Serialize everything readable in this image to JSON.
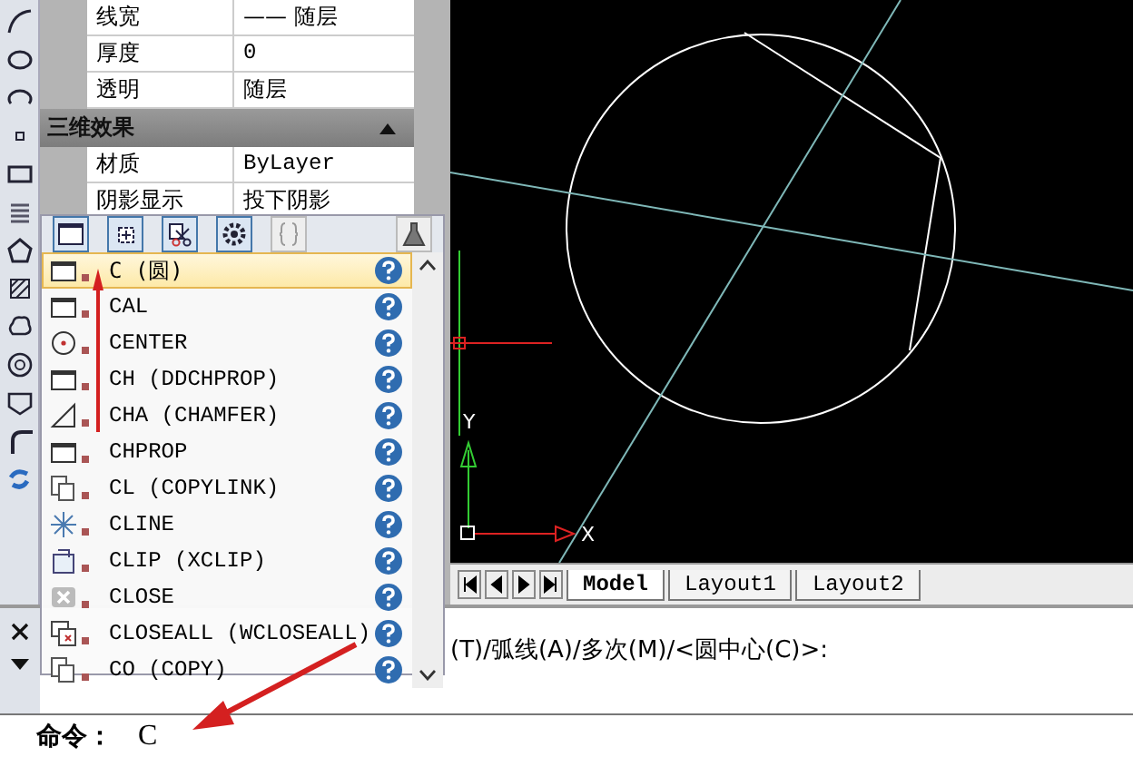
{
  "properties": {
    "rows": [
      {
        "label": "线宽",
        "value": "—— 随层"
      },
      {
        "label": "厚度",
        "value": "0"
      },
      {
        "label": "透明",
        "value": "随层"
      }
    ],
    "section": {
      "title": "三维效果",
      "expanded": true
    },
    "section_rows": [
      {
        "label": "材质",
        "value": "ByLayer"
      },
      {
        "label": "阴影显示",
        "value": "投下阴影"
      }
    ]
  },
  "autocomplete": {
    "items": [
      {
        "kind": "window",
        "label": "C (圆)",
        "selected": true
      },
      {
        "kind": "window",
        "label": "CAL",
        "selected": false
      },
      {
        "kind": "center",
        "label": "CENTER",
        "selected": false
      },
      {
        "kind": "window",
        "label": "CH (DDCHPROP)",
        "selected": false
      },
      {
        "kind": "chamfer",
        "label": "CHA (CHAMFER)",
        "selected": false
      },
      {
        "kind": "window",
        "label": "CHPROP",
        "selected": false
      },
      {
        "kind": "link",
        "label": "CL (COPYLINK)",
        "selected": false
      },
      {
        "kind": "cline",
        "label": "CLINE",
        "selected": false
      },
      {
        "kind": "clip",
        "label": "CLIP (XCLIP)",
        "selected": false
      },
      {
        "kind": "close",
        "label": "CLOSE",
        "selected": false
      },
      {
        "kind": "closeall",
        "label": "CLOSEALL (WCLOSEALL)",
        "selected": false
      },
      {
        "kind": "link",
        "label": "CO (COPY)",
        "selected": false
      }
    ]
  },
  "ucs": {
    "x_label": "X",
    "y_label": "Y"
  },
  "layout_tabs": [
    {
      "label": "Model",
      "selected": true
    },
    {
      "label": "Layout1",
      "selected": false
    },
    {
      "label": "Layout2",
      "selected": false
    }
  ],
  "command_history": "(T)/弧线(A)/多次(M)/<圆中心(C)>:",
  "command_line": {
    "prompt": "命令：",
    "value": "C"
  }
}
